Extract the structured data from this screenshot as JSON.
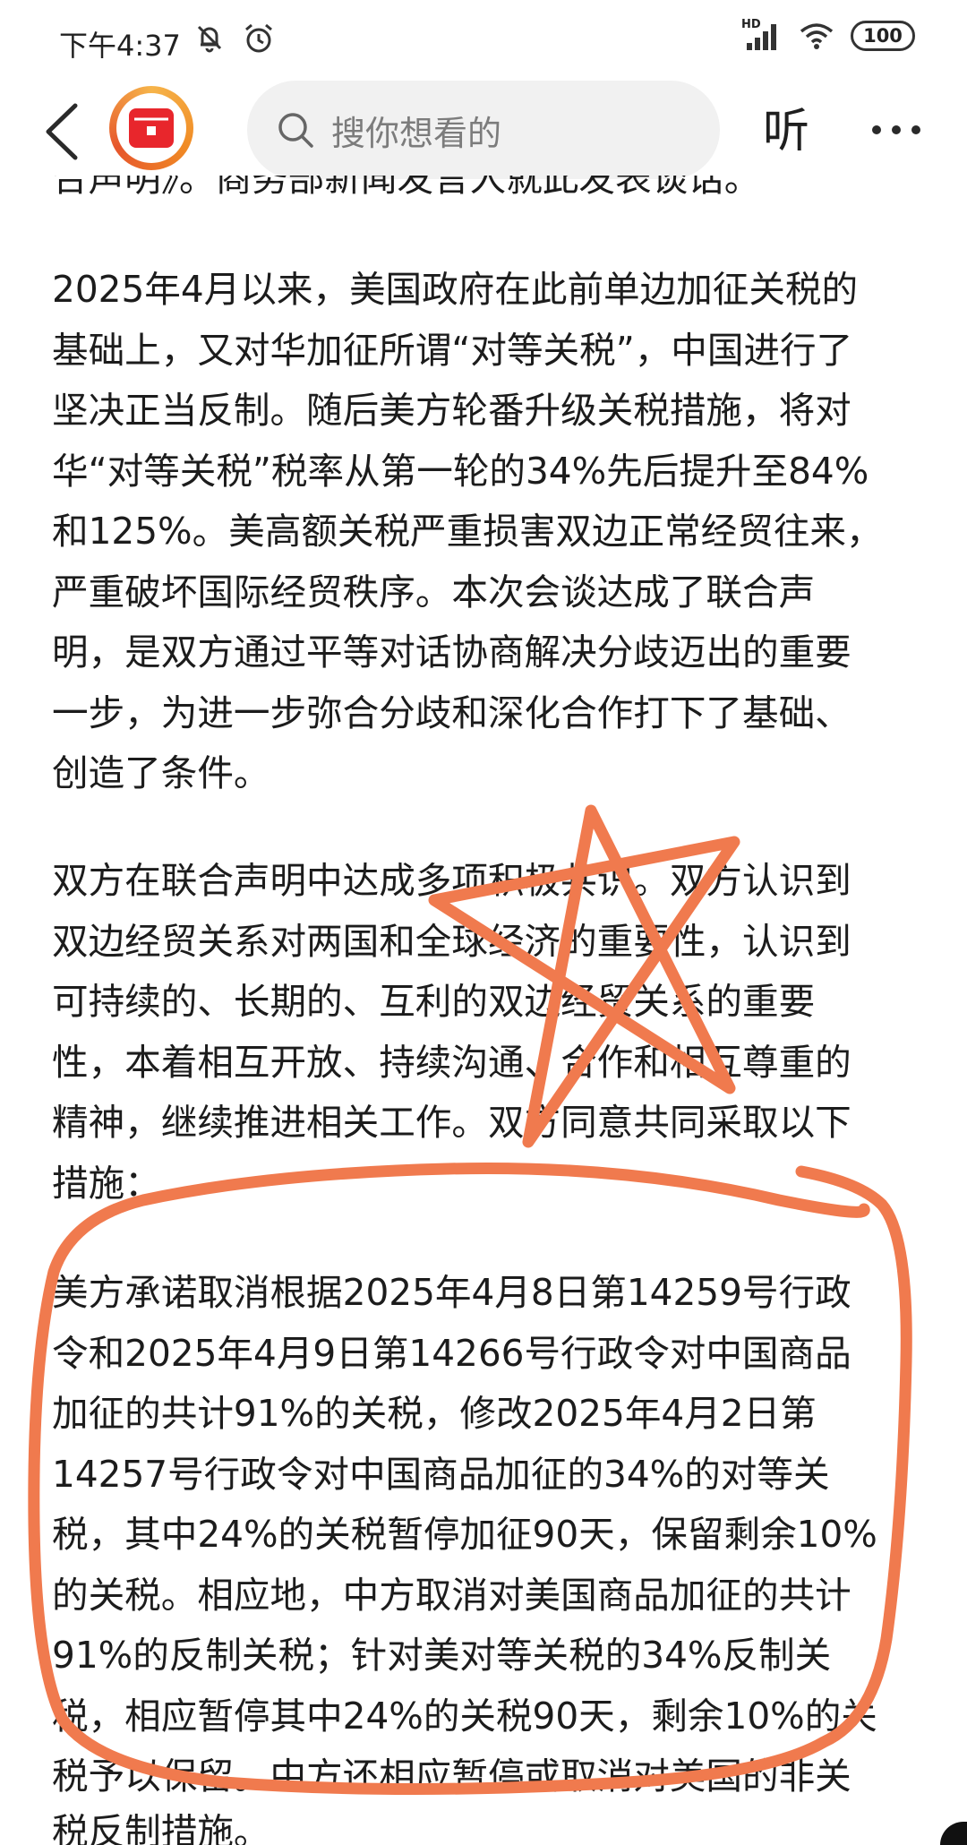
{
  "status_bar": {
    "time": "下午4:37",
    "network_label": "HD",
    "battery": "100",
    "icons": [
      "bell-off-icon",
      "alarm-icon",
      "signal-icon",
      "wifi-icon",
      "battery-icon"
    ]
  },
  "nav": {
    "search_placeholder": "搜你想看的",
    "listen_label": "听",
    "icons": [
      "back-arrow-icon",
      "app-logo",
      "search-icon",
      "more-icon"
    ]
  },
  "article": {
    "cut_top_line": "合声明》。商务部新闻发言人就此发表谈话。",
    "paragraphs": [
      {
        "lines": [
          "2025年4月以来，美国政府在此前单边加征关税的",
          "基础上，又对华加征所谓“对等关税”，中国进行了",
          "坚决正当反制。随后美方轮番升级关税措施，将对",
          "华“对等关税”税率从第一轮的34%先后提升至84%",
          "和125%。美高额关税严重损害双边正常经贸往来，",
          "严重破坏国际经贸秩序。本次会谈达成了联合声",
          "明，是双方通过平等对话协商解决分歧迈出的重要",
          "一步，为进一步弥合分歧和深化合作打下了基础、",
          "创造了条件。"
        ]
      },
      {
        "lines": [
          "双方在联合声明中达成多项积极共识。双方认识到",
          "双边经贸关系对两国和全球经济的重要性，认识到",
          "可持续的、长期的、互利的双边经贸关系的重要",
          "性，本着相互开放、持续沟通、合作和相互尊重的",
          "精神，继续推进相关工作。双方同意共同采取以下",
          "措施："
        ]
      },
      {
        "lines": [
          "美方承诺取消根据2025年4月8日第14259号行政",
          "令和2025年4月9日第14266号行政令对中国商品",
          "加征的共计91%的关税，修改2025年4月2日第",
          "14257号行政令对中国商品加征的34%的对等关",
          "税，其中24%的关税暂停加征90天，保留剩余10%",
          "的关税。相应地，中方取消对美国商品加征的共计",
          "91%的反制关税；针对美对等关税的34%反制关",
          "税，相应暂停其中24%的关税90天，剩余10%的关",
          "税予以保留。中方还相应暂停或取消对美国的非关"
        ]
      }
    ],
    "cut_bottom_line": "税反制措施。"
  },
  "annotations": {
    "color": "#f07a4e"
  }
}
